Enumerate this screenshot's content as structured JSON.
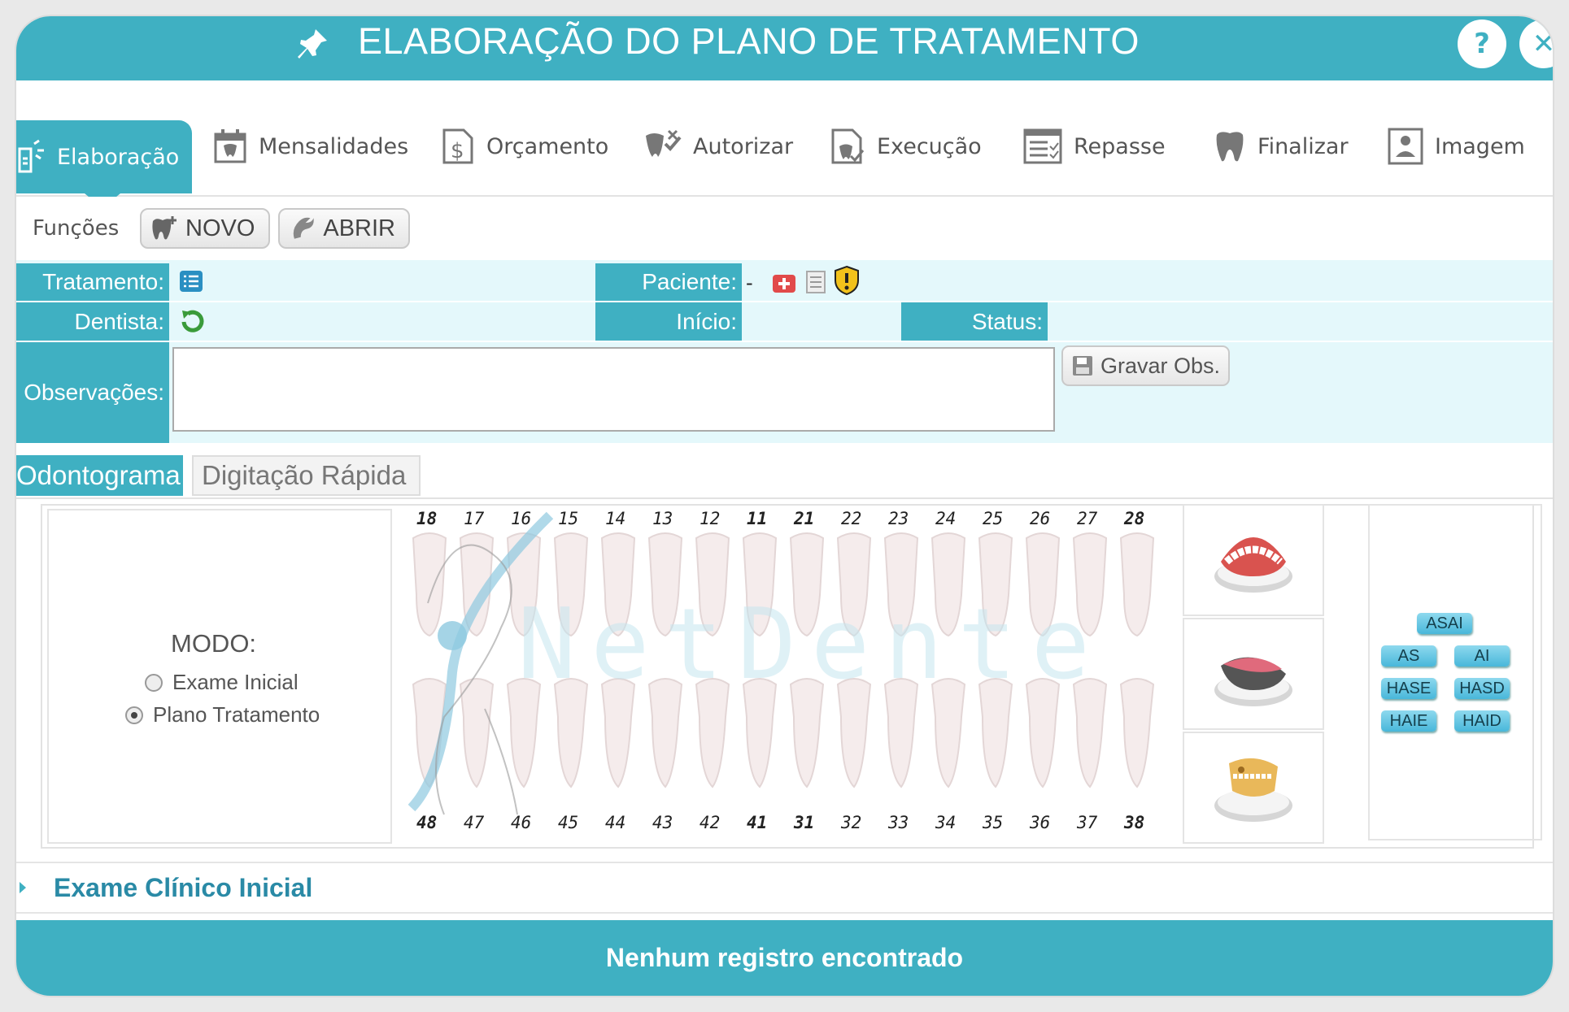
{
  "window": {
    "title": "ELABORAÇÃO DO PLANO DE TRATAMENTO",
    "accent_color": "#3fb0c2"
  },
  "tabs": [
    {
      "label": "Elaboração",
      "icon": "elaboration-icon",
      "active": true
    },
    {
      "label": "Mensalidades",
      "icon": "calendar-icon"
    },
    {
      "label": "Orçamento",
      "icon": "budget-icon"
    },
    {
      "label": "Autorizar",
      "icon": "authorize-icon"
    },
    {
      "label": "Execução",
      "icon": "execution-icon"
    },
    {
      "label": "Repasse",
      "icon": "list-check-icon"
    },
    {
      "label": "Finalizar",
      "icon": "tooth-icon"
    },
    {
      "label": "Imagem",
      "icon": "image-icon"
    }
  ],
  "functions": {
    "label": "Funções",
    "new_label": "NOVO",
    "open_label": "ABRIR"
  },
  "form": {
    "tratamento_label": "Tratamento:",
    "paciente_label": "Paciente:",
    "paciente_value": "-",
    "dentista_label": "Dentista:",
    "inicio_label": "Início:",
    "status_label": "Status:",
    "observacoes_label": "Observações:",
    "observacoes_value": "",
    "gravar_label": "Gravar Obs."
  },
  "subtabs": {
    "odontograma": "Odontograma",
    "digitacao": "Digitação Rápida"
  },
  "odontogram": {
    "mode_title": "MODO:",
    "mode_options": [
      "Exame Inicial",
      "Plano Tratamento"
    ],
    "selected_mode": "Plano Tratamento",
    "upper_teeth": [
      "18",
      "17",
      "16",
      "15",
      "14",
      "13",
      "12",
      "11",
      "21",
      "22",
      "23",
      "24",
      "25",
      "26",
      "27",
      "28"
    ],
    "lower_teeth": [
      "48",
      "47",
      "46",
      "45",
      "44",
      "43",
      "42",
      "41",
      "31",
      "32",
      "33",
      "34",
      "35",
      "36",
      "37",
      "38"
    ],
    "watermark": "NetDente",
    "arch_chips": [
      "ASAI",
      "AS",
      "AI",
      "HASE",
      "HASD",
      "HAIE",
      "HAID"
    ]
  },
  "sections": {
    "exame_clinico": "Exame Clínico Inicial"
  },
  "footer": {
    "message": "Nenhum registro encontrado"
  }
}
